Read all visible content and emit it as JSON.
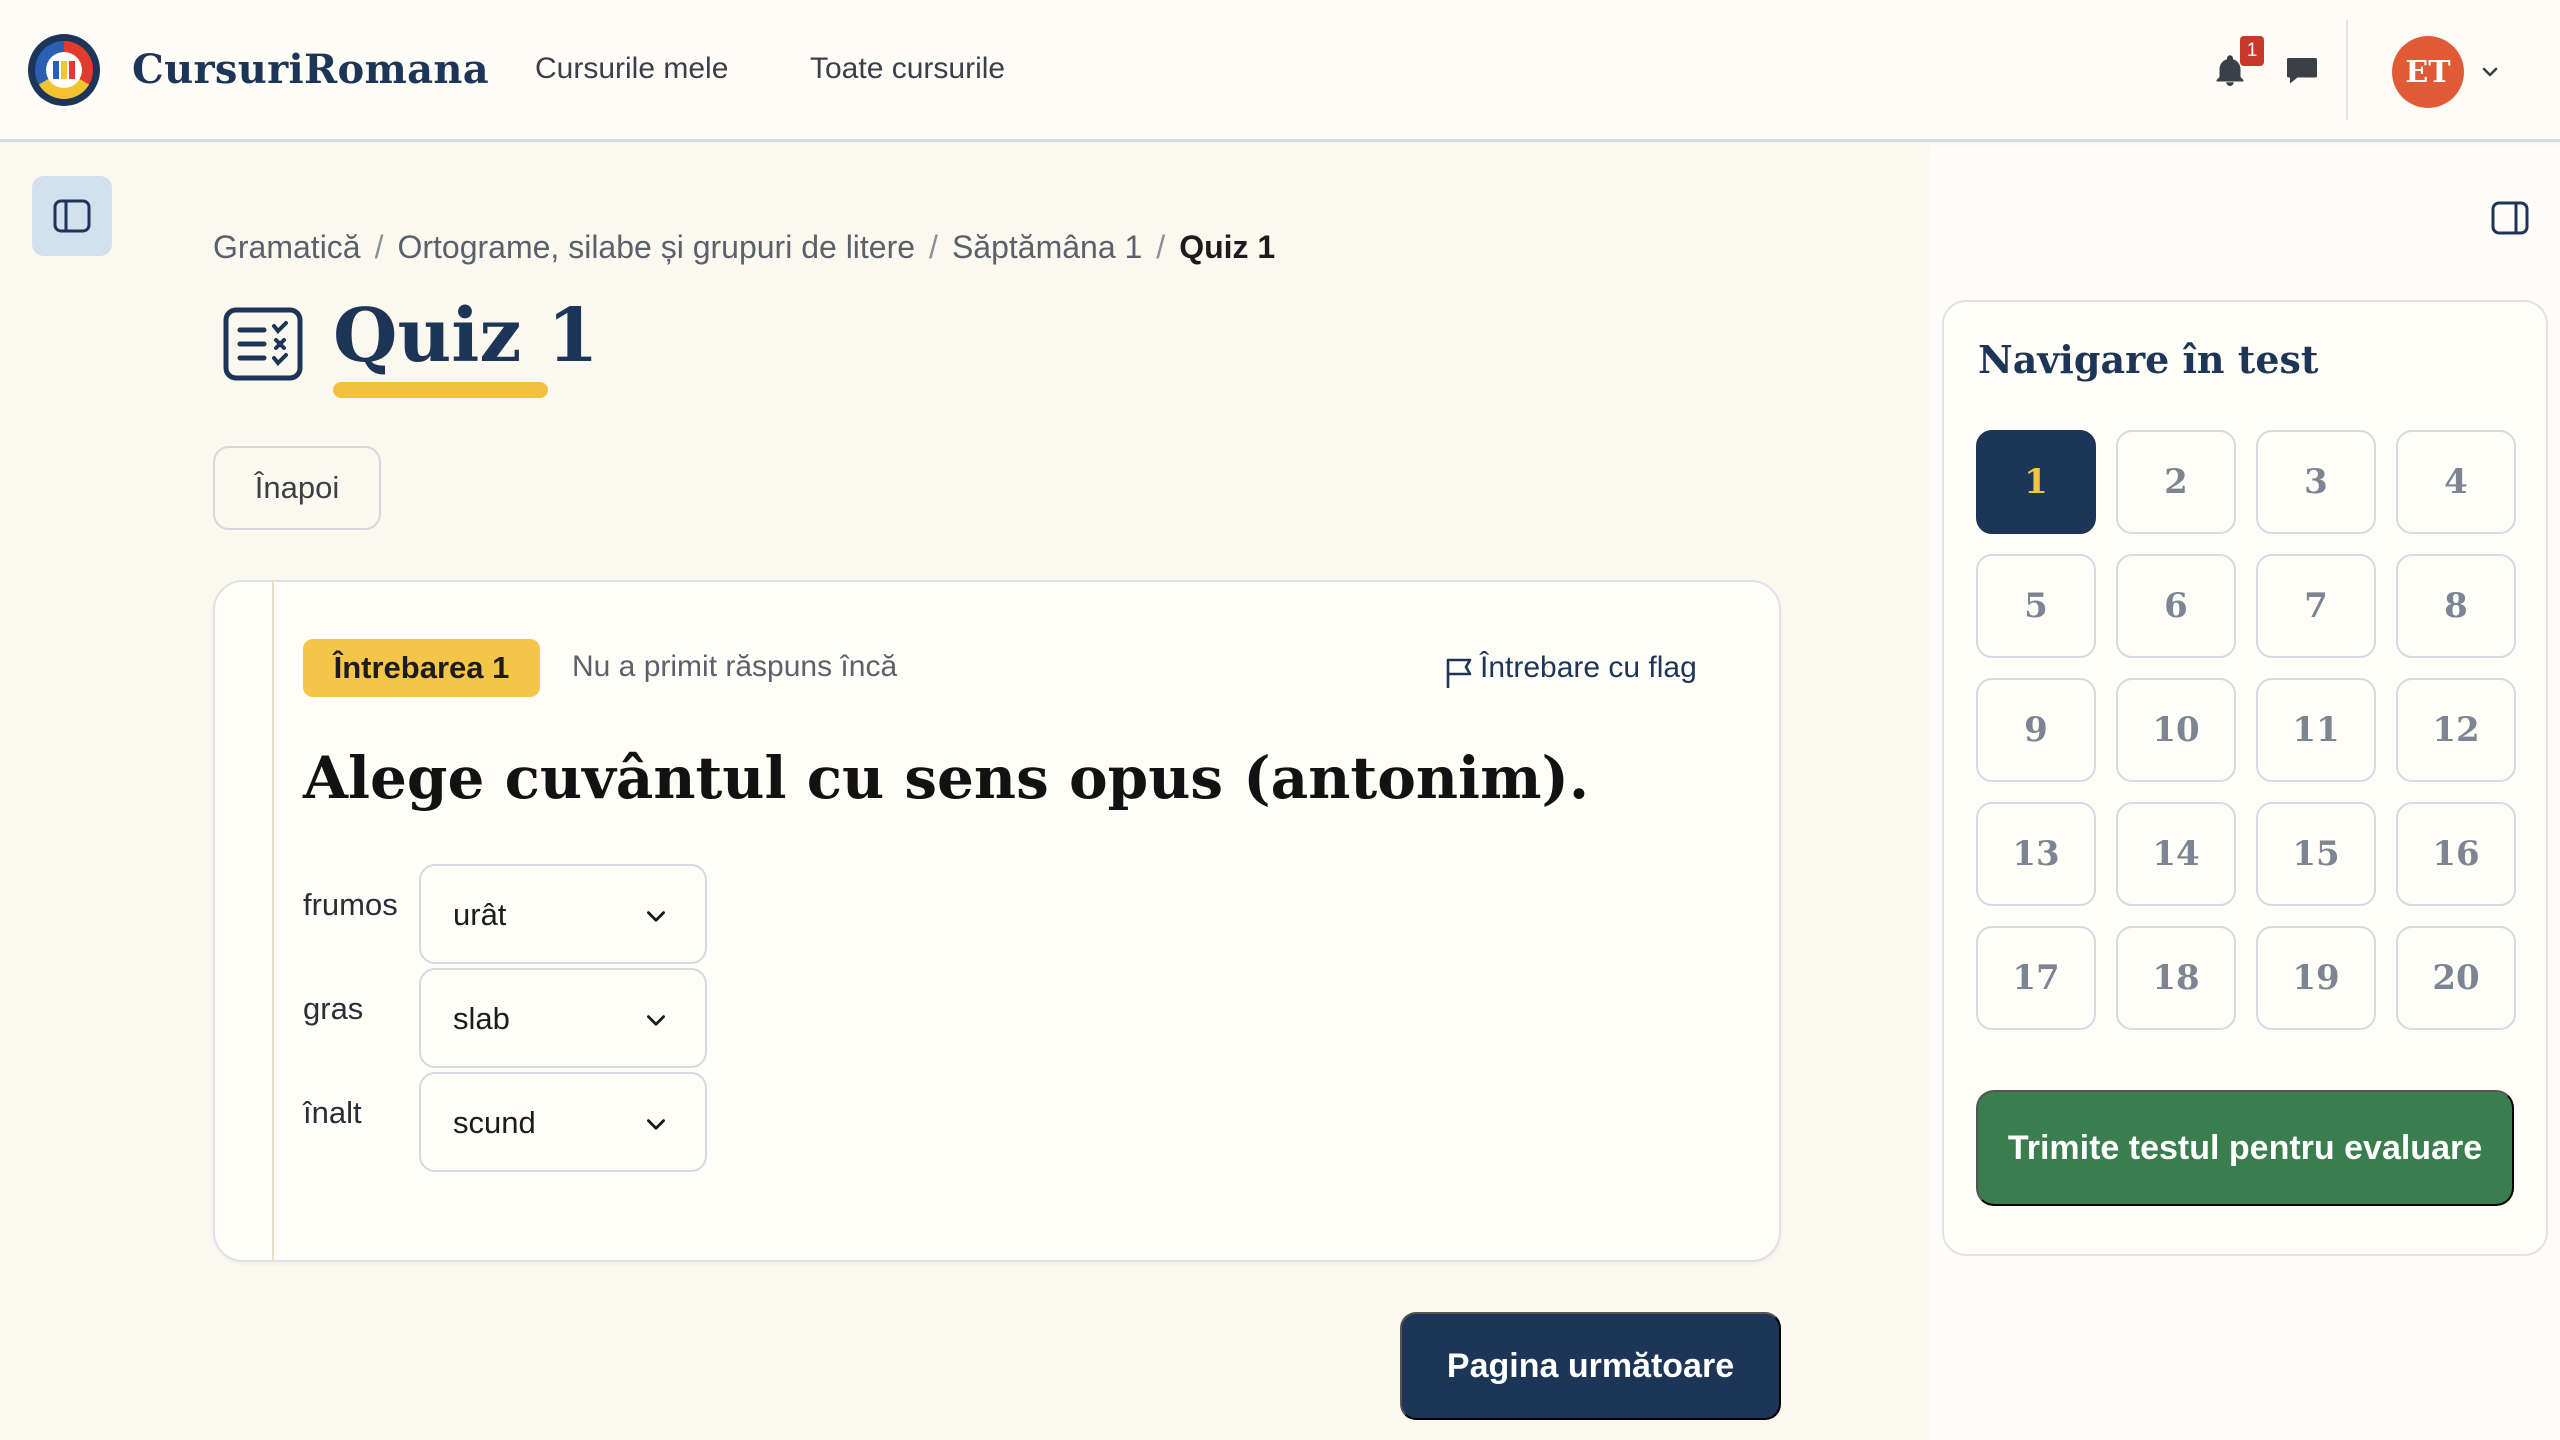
{
  "header": {
    "brand": "CursuriRomana",
    "nav": [
      "Cursurile mele",
      "Toate cursurile"
    ],
    "notification_count": "1",
    "user_initials": "ET"
  },
  "breadcrumb": {
    "items": [
      "Gramatică",
      "Ortograme, silabe și grupuri de litere",
      "Săptămâna 1"
    ],
    "current": "Quiz 1",
    "separator": "/"
  },
  "page": {
    "title": "Quiz 1",
    "back_label": "Înapoi"
  },
  "question": {
    "number_label": "Întrebarea 1",
    "status": "Nu a primit răspuns încă",
    "flag_label": "Întrebare cu flag",
    "text": "Alege cuvântul cu sens opus (antonim).",
    "pairs": [
      {
        "word": "frumos",
        "answer": "urât"
      },
      {
        "word": "gras",
        "answer": "slab"
      },
      {
        "word": "înalt",
        "answer": "scund"
      }
    ]
  },
  "next_button": "Pagina următoare",
  "quiz_nav": {
    "title": "Navigare în test",
    "questions": [
      "1",
      "2",
      "3",
      "4",
      "5",
      "6",
      "7",
      "8",
      "9",
      "10",
      "11",
      "12",
      "13",
      "14",
      "15",
      "16",
      "17",
      "18",
      "19",
      "20"
    ],
    "current": "1",
    "submit_label": "Trimite testul pentru evaluare"
  },
  "colors": {
    "primary": "#1d3557",
    "accent_yellow": "#f4c548",
    "submit_green": "#3a7d4f",
    "avatar": "#e05a35",
    "badge_red": "#c73a2b"
  },
  "icons": [
    "bell-icon",
    "chat-icon",
    "chevron-down-icon",
    "sidebar-left-icon",
    "sidebar-right-icon",
    "quiz-list-icon",
    "flag-icon"
  ]
}
